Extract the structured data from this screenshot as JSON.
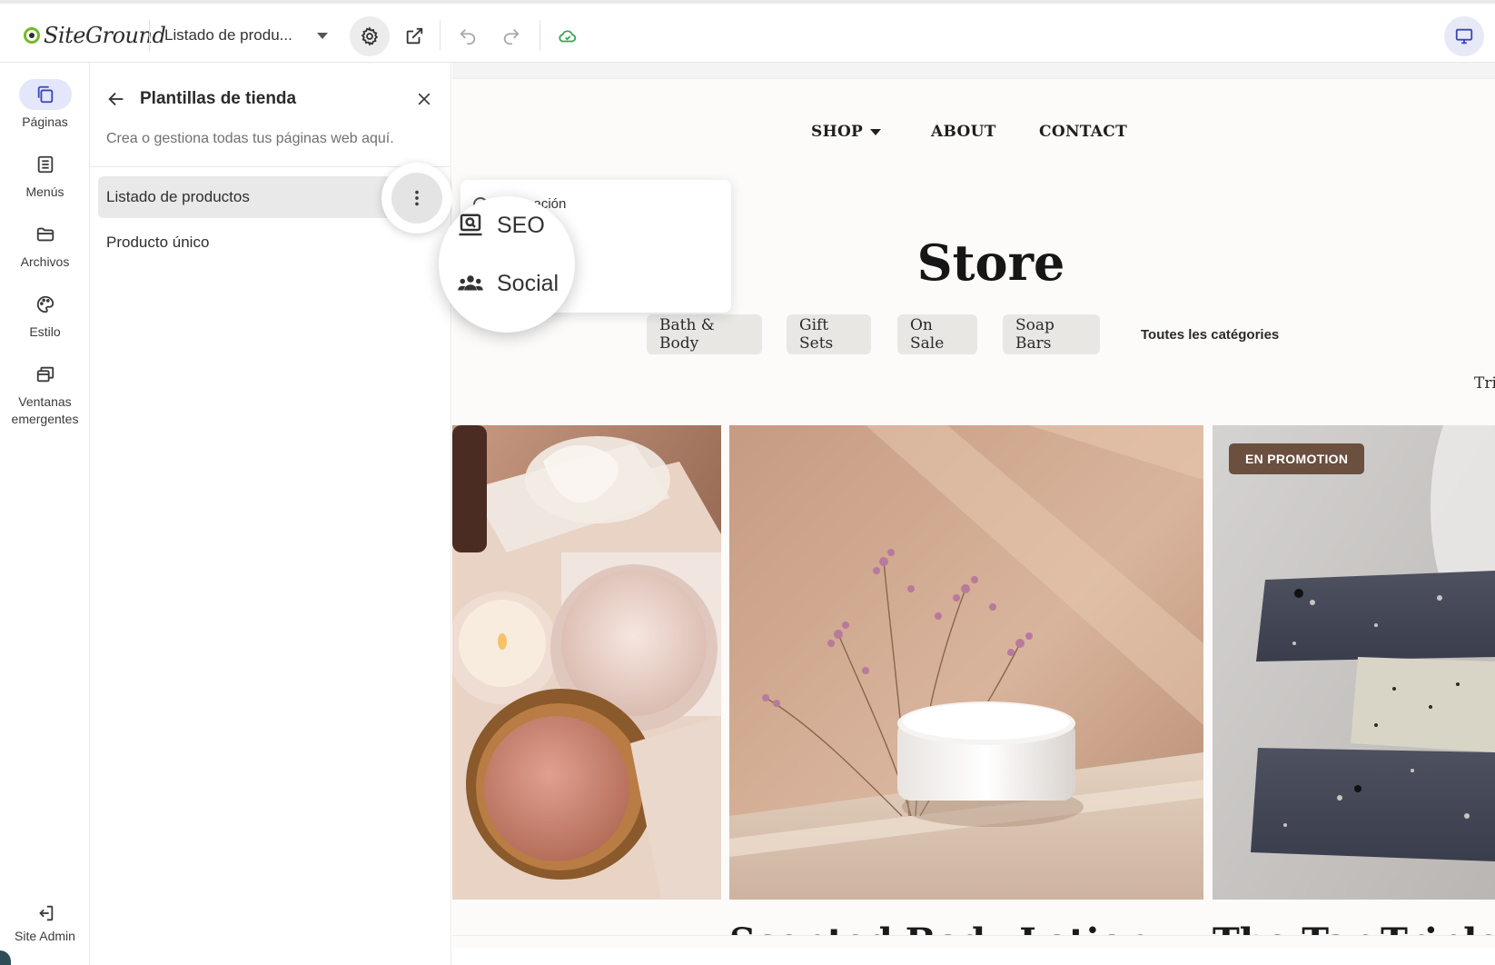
{
  "app": {
    "brand": "SiteGround"
  },
  "toolbar": {
    "page_selector": "Listado de produ..."
  },
  "rail": {
    "items": [
      {
        "label": "Páginas",
        "icon": "pages-icon"
      },
      {
        "label": "Menús",
        "icon": "menu-list-icon"
      },
      {
        "label": "Archivos",
        "icon": "folder-icon"
      },
      {
        "label": "Estilo",
        "icon": "palette-icon"
      },
      {
        "label": "Ventanas emergentes",
        "icon": "popups-icon"
      }
    ],
    "site_admin": "Site Admin"
  },
  "panel": {
    "title": "Plantillas de tienda",
    "description": "Crea o gestiona todas tus páginas web aquí.",
    "items": [
      {
        "label": "Listado de productos"
      },
      {
        "label": "Producto único"
      }
    ]
  },
  "context_menu": {
    "info": "Información",
    "seo": "SEO",
    "social": "Social"
  },
  "site": {
    "nav": {
      "shop": "SHOP",
      "about": "ABOUT",
      "contact": "CONTACT"
    },
    "title": "Store",
    "categories": [
      "Bath & Body",
      "Gift Sets",
      "On Sale",
      "Soap Bars"
    ],
    "all_categories": "Toutes les catégories",
    "sort_partial": "Tri",
    "products": [
      {
        "name": ""
      },
      {
        "name": "Scented Body Lotion"
      },
      {
        "name": "The Tar Triplet",
        "badge": "EN PROMOTION"
      }
    ]
  },
  "colors": {
    "accent": "#e4e6fb",
    "brand_green": "#76b82a",
    "badge": "#6b4f3f"
  }
}
